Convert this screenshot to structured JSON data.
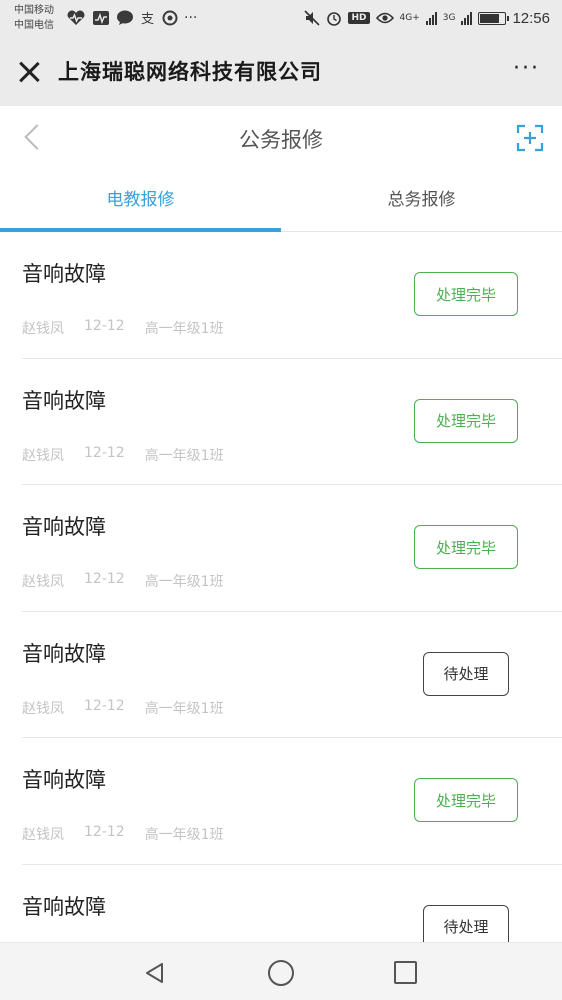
{
  "status_bar": {
    "carrier_1": "中国移动",
    "carrier_2": "中国电信",
    "network_1": "4G+",
    "network_2": "3G",
    "time": "12:56",
    "battery_level": 0.7,
    "icons_left": [
      "heart-pulse-icon",
      "activity-icon",
      "chat-icon",
      "alipay-icon",
      "browser-icon",
      "more-dots-icon"
    ],
    "icons_right": [
      "mute-icon",
      "alarm-icon",
      "hd-icon",
      "eye-icon",
      "signal-icon",
      "signal-icon",
      "battery-icon"
    ]
  },
  "title_bar": {
    "title": "上海瑞聪网络科技有限公司",
    "more": "···"
  },
  "nav": {
    "title": "公务报修"
  },
  "tabs": [
    {
      "label": "电教报修",
      "active": true
    },
    {
      "label": "总务报修",
      "active": false
    }
  ],
  "items": [
    {
      "title": "音响故障",
      "name": "赵钱凤",
      "date": "12-12",
      "class": "高一年级1班",
      "status": "处理完毕",
      "status_type": "done"
    },
    {
      "title": "音响故障",
      "name": "赵钱凤",
      "date": "12-12",
      "class": "高一年级1班",
      "status": "处理完毕",
      "status_type": "done"
    },
    {
      "title": "音响故障",
      "name": "赵钱凤",
      "date": "12-12",
      "class": "高一年级1班",
      "status": "处理完毕",
      "status_type": "done"
    },
    {
      "title": "音响故障",
      "name": "赵钱凤",
      "date": "12-12",
      "class": "高一年级1班",
      "status": "待处理",
      "status_type": "pending"
    },
    {
      "title": "音响故障",
      "name": "赵钱凤",
      "date": "12-12",
      "class": "高一年级1班",
      "status": "处理完毕",
      "status_type": "done"
    },
    {
      "title": "音响故障",
      "name": "",
      "date": "",
      "class": "",
      "status": "待处理",
      "status_type": "pending"
    }
  ],
  "colors": {
    "accent": "#3aa0d8",
    "done": "#4caf50",
    "pending": "#444444",
    "meta_text": "#c4c4c4"
  }
}
